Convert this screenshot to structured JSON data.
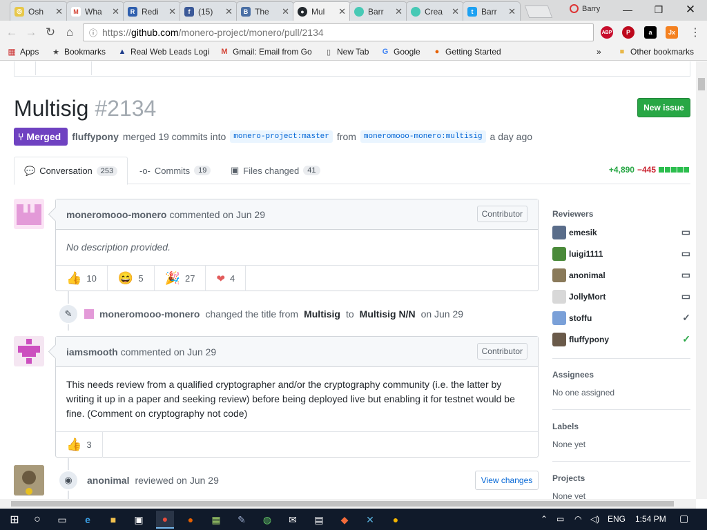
{
  "browser": {
    "tabs": [
      {
        "label": "Osh",
        "favicon": "osh-icon",
        "color": "#e7c84a"
      },
      {
        "label": "Wha",
        "favicon": "gmail-icon",
        "color": "#d44638"
      },
      {
        "label": "Redi",
        "favicon": "reddit-icon",
        "color": "#2f5fae"
      },
      {
        "label": "(15)",
        "favicon": "facebook-icon",
        "color": "#3b5998"
      },
      {
        "label": "The",
        "favicon": "bitcoin-icon",
        "color": "#4a6fa5"
      },
      {
        "label": "Mul",
        "favicon": "github-icon",
        "color": "#24292e"
      },
      {
        "label": "Barr",
        "favicon": "tab-blob-icon",
        "color": "#46c9b5"
      },
      {
        "label": "Crea",
        "favicon": "tab-blob-icon",
        "color": "#46c9b5"
      },
      {
        "label": "Barr",
        "favicon": "twitter-icon",
        "color": "#1da1f2"
      }
    ],
    "profile_name": "Barry",
    "url": {
      "scheme": "https://",
      "host": "github.com",
      "path": "/monero-project/monero/pull/2134"
    },
    "extensions": [
      {
        "label": "ABP",
        "badge": "3",
        "color": "#c70d2c"
      },
      {
        "label": "P",
        "color": "#bd081c"
      },
      {
        "label": "a",
        "badge": "5",
        "color": "#000000"
      },
      {
        "label": "Jx",
        "color": "#f48120"
      }
    ],
    "bookmarks": [
      {
        "label": "Apps",
        "icon": "apps-grid-icon"
      },
      {
        "label": "Bookmarks",
        "icon": "star-icon"
      },
      {
        "label": "Real Web Leads Logi",
        "icon": "leads-icon"
      },
      {
        "label": "Gmail: Email from Go",
        "icon": "gmail-icon"
      },
      {
        "label": "New Tab",
        "icon": "page-icon"
      },
      {
        "label": "Google",
        "icon": "google-icon"
      },
      {
        "label": "Getting Started",
        "icon": "firefox-icon"
      }
    ],
    "bookmarks_overflow": "»",
    "other_bookmarks": "Other bookmarks"
  },
  "pr": {
    "title": "Multisig",
    "number": "#2134",
    "new_issue": "New issue",
    "state": "Merged",
    "author": "fluffypony",
    "merge_text": "merged 19 commits into",
    "base_branch": "monero-project:master",
    "from_text": "from",
    "head_branch": "moneromooo-monero:multisig",
    "when": "a day ago",
    "tabs": [
      {
        "label": "Conversation",
        "count": "253",
        "icon": "comment-discussion-icon"
      },
      {
        "label": "Commits",
        "count": "19",
        "icon": "git-commit-icon"
      },
      {
        "label": "Files changed",
        "count": "41",
        "icon": "file-diff-icon"
      }
    ],
    "additions": "+4,890",
    "deletions": "−445"
  },
  "timeline": {
    "comment1": {
      "author": "moneromooo-monero",
      "action": "commented on Jun 29",
      "role": "Contributor",
      "body": "No description provided.",
      "reactions": [
        {
          "emoji": "👍",
          "count": "10",
          "name": "thumbs-up-icon"
        },
        {
          "emoji": "😄",
          "count": "5",
          "name": "smile-icon"
        },
        {
          "emoji": "🎉",
          "count": "27",
          "name": "tada-icon"
        },
        {
          "emoji": "❤",
          "count": "4",
          "name": "heart-icon"
        }
      ]
    },
    "rename": {
      "author": "moneromooo-monero",
      "text1": "changed the title from",
      "old_title": "Multisig",
      "text2": "to",
      "new_title": "Multisig N/N",
      "text3": "on Jun 29"
    },
    "comment2": {
      "author": "iamsmooth",
      "action": "commented on Jun 29",
      "role": "Contributor",
      "body": "This needs review from a qualified cryptographer and/or the cryptography community (i.e. the latter by writing it up in a paper and seeking review) before being deployed live but enabling it for testnet would be fine. (Comment on cryptography not code)",
      "reactions": [
        {
          "emoji": "👍",
          "count": "3",
          "name": "thumbs-up-icon"
        }
      ]
    },
    "review": {
      "author": "anonimal",
      "action": "reviewed on Jun 29",
      "button": "View changes"
    }
  },
  "sidebar": {
    "reviewers_title": "Reviewers",
    "reviewers": [
      {
        "name": "emesik",
        "status": "comment-icon",
        "color": "#5a6d8a"
      },
      {
        "name": "luigi1111",
        "status": "comment-icon",
        "color": "#4a8a3a"
      },
      {
        "name": "anonimal",
        "status": "comment-icon",
        "color": "#8a7a5a"
      },
      {
        "name": "JollyMort",
        "status": "comment-icon",
        "color": "#d8d8d8"
      },
      {
        "name": "stoffu",
        "status": "check-icon",
        "color": "#7aa0d8"
      },
      {
        "name": "fluffypony",
        "status": "check-icon",
        "color": "#6a5a4a"
      }
    ],
    "assignees_title": "Assignees",
    "assignees_value": "No one assigned",
    "labels_title": "Labels",
    "labels_value": "None yet",
    "projects_title": "Projects",
    "projects_value": "None yet"
  },
  "taskbar": {
    "language": "ENG",
    "time": "1:54 PM"
  }
}
